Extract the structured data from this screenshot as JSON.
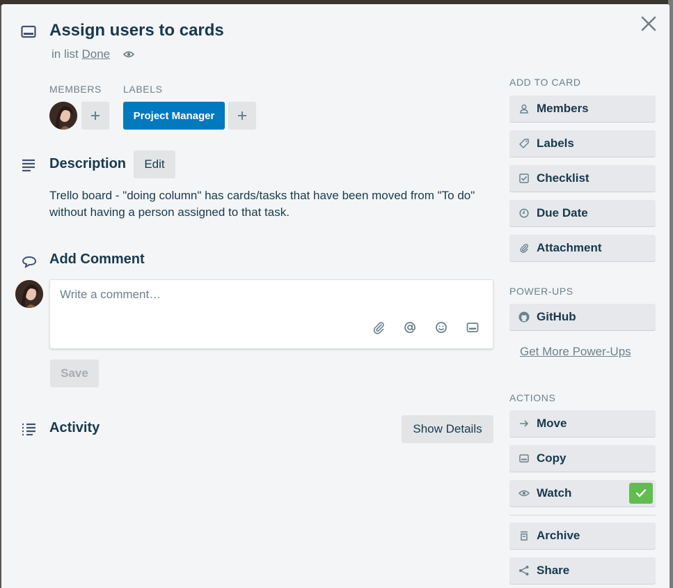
{
  "card": {
    "title": "Assign users to cards",
    "list_prefix": "in list",
    "list_name": "Done"
  },
  "members": {
    "heading": "MEMBERS"
  },
  "labels": {
    "heading": "LABELS",
    "items": [
      {
        "text": "Project Manager",
        "color": "#0079bf"
      }
    ]
  },
  "description": {
    "heading": "Description",
    "edit_label": "Edit",
    "text": "Trello board - \"doing column\" has cards/tasks that have been moved from \"To do\" without having a person assigned to that task."
  },
  "comment": {
    "heading": "Add Comment",
    "placeholder": "Write a comment…",
    "save_label": "Save"
  },
  "activity": {
    "heading": "Activity",
    "show_details_label": "Show Details"
  },
  "sidebar": {
    "add_to_card": {
      "heading": "ADD TO CARD",
      "items": [
        {
          "label": "Members",
          "icon": "person-icon"
        },
        {
          "label": "Labels",
          "icon": "tag-icon"
        },
        {
          "label": "Checklist",
          "icon": "checkbox-icon"
        },
        {
          "label": "Due Date",
          "icon": "clock-icon"
        },
        {
          "label": "Attachment",
          "icon": "paperclip-icon"
        }
      ]
    },
    "power_ups": {
      "heading": "POWER-UPS",
      "items": [
        {
          "label": "GitHub",
          "icon": "github-icon"
        }
      ],
      "more_link": "Get More Power-Ups"
    },
    "actions": {
      "heading": "ACTIONS",
      "items": [
        {
          "label": "Move",
          "icon": "arrow-right-icon"
        },
        {
          "label": "Copy",
          "icon": "card-icon"
        },
        {
          "label": "Watch",
          "icon": "eye-icon",
          "checked": true
        },
        {
          "label": "Archive",
          "icon": "archive-icon"
        },
        {
          "label": "Share",
          "icon": "share-icon"
        }
      ]
    }
  },
  "colors": {
    "accent": "#0079bf",
    "watch_check": "#61bd4f",
    "background": "#f4f5f7",
    "text": "#17394d"
  }
}
